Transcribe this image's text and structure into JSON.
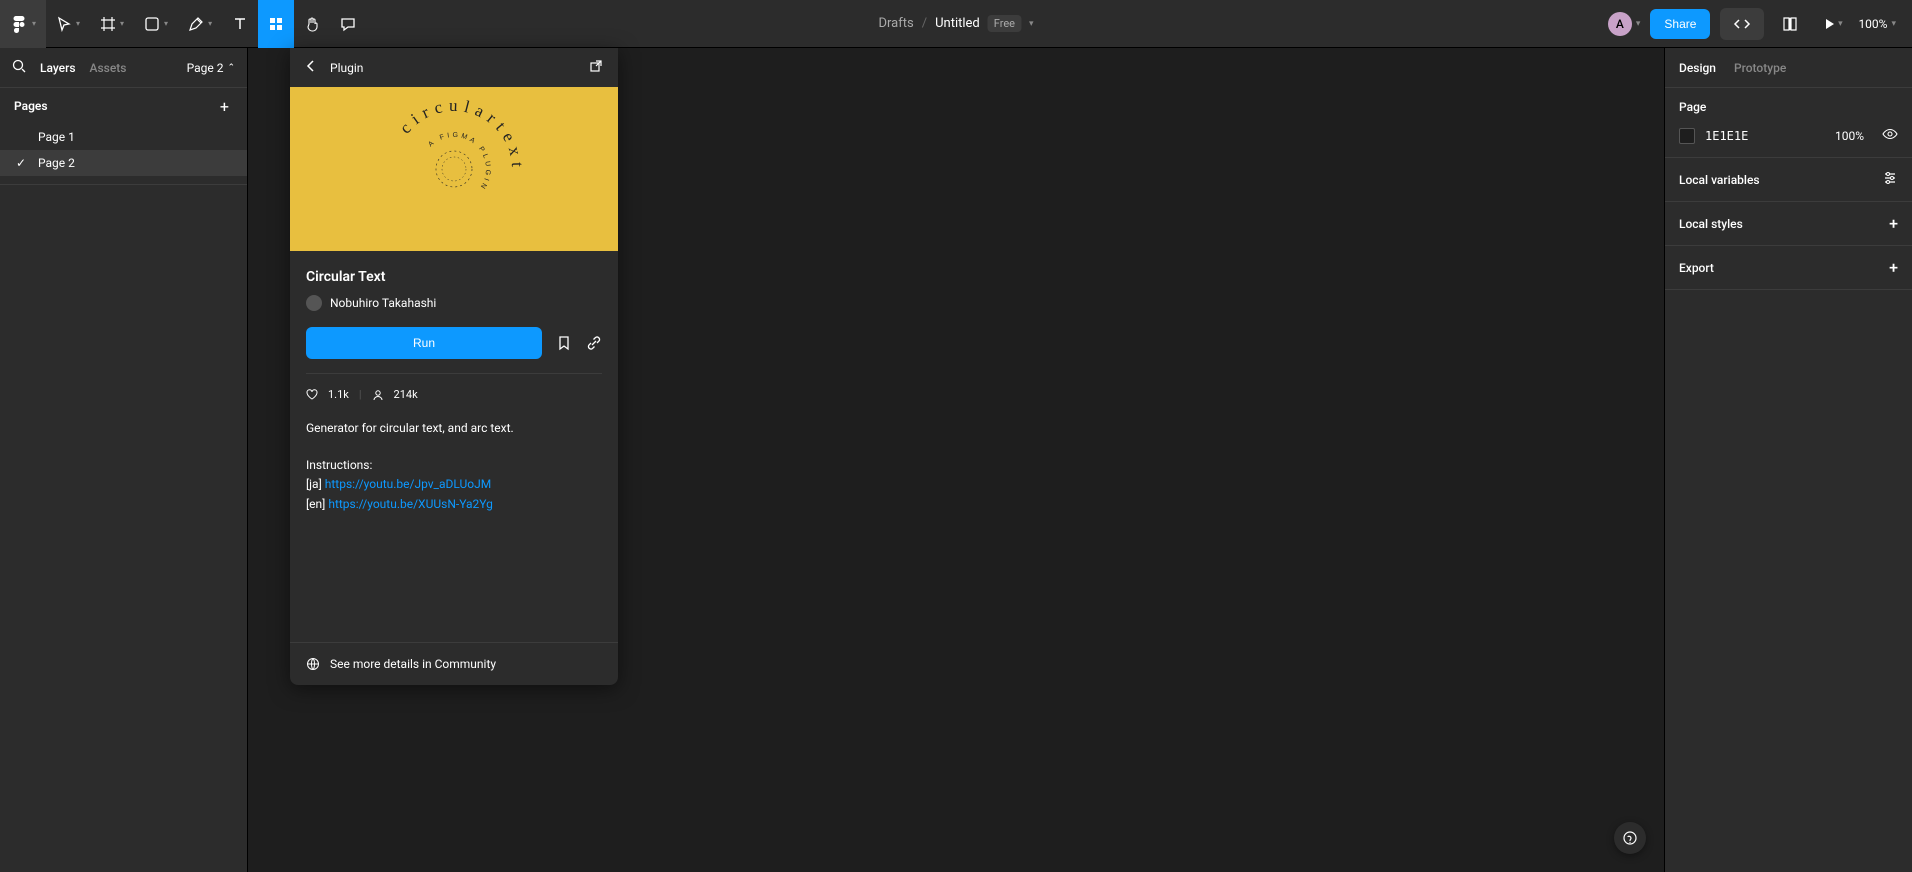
{
  "breadcrumb": {
    "drafts": "Drafts",
    "fileName": "Untitled",
    "badge": "Free"
  },
  "toolbarRight": {
    "avatarInitial": "A",
    "shareLabel": "Share",
    "zoom": "100%"
  },
  "leftPanel": {
    "tabs": {
      "layers": "Layers",
      "assets": "Assets"
    },
    "pageSelectorLabel": "Page 2",
    "pagesTitle": "Pages",
    "pages": [
      {
        "name": "Page 1",
        "selected": false
      },
      {
        "name": "Page 2",
        "selected": true
      }
    ]
  },
  "pluginPanel": {
    "headerTitle": "Plugin",
    "name": "Circular Text",
    "author": "Nobuhiro Takahashi",
    "runLabel": "Run",
    "likes": "1.1k",
    "uses": "214k",
    "heroOuterText": "circulartext",
    "heroMidText": "A FIGMA PLUGIN",
    "description": "Generator for circular text, and arc text.",
    "instructionsTitle": "Instructions:",
    "jaPrefix": "[ja] ",
    "jaLink": "https://youtu.be/Jpv_aDLUoJM",
    "enPrefix": "[en] ",
    "enLink": "https://youtu.be/XUUsN-Ya2Yg",
    "communityLink": "See more details in Community"
  },
  "rightPanel": {
    "tabs": {
      "design": "Design",
      "prototype": "Prototype"
    },
    "pageSection": {
      "title": "Page",
      "hex": "1E1E1E",
      "opacity": "100%",
      "swatchColor": "#1E1E1E"
    },
    "localVariables": "Local variables",
    "localStyles": "Local styles",
    "export": "Export"
  }
}
